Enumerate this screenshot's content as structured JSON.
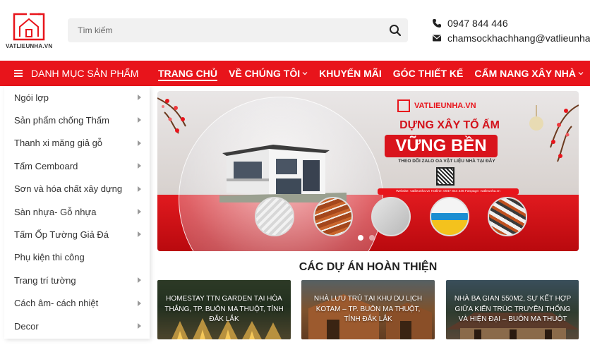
{
  "header": {
    "logo_text": "VATLIEUNHA.VN",
    "search_placeholder": "Tìm kiếm",
    "phone": "0947 844 446",
    "email": "chamsockhachhang@vatlieunha"
  },
  "nav": {
    "category_label": "DANH MỤC SẢN PHẨM",
    "items": [
      {
        "label": "TRANG CHỦ",
        "active": true
      },
      {
        "label": "VỀ CHÚNG TÔI",
        "dropdown": true
      },
      {
        "label": "KHUYẾN MÃI"
      },
      {
        "label": "GÓC THIẾT KẾ"
      },
      {
        "label": "CẨM NANG XÂY NHÀ",
        "dropdown": true
      }
    ]
  },
  "sidebar": {
    "items": [
      {
        "label": "Ngói lợp",
        "has_sub": true
      },
      {
        "label": "Sản phẩm chống Thấm",
        "has_sub": true
      },
      {
        "label": "Thanh xi măng giả gỗ",
        "has_sub": true
      },
      {
        "label": "Tấm Cemboard",
        "has_sub": true
      },
      {
        "label": "Sơn và hóa chất xây dựng",
        "has_sub": true
      },
      {
        "label": "Sàn nhựa- Gỗ nhựa",
        "has_sub": true
      },
      {
        "label": "Tấm Ốp Tường Giả Đá",
        "has_sub": true
      },
      {
        "label": "Phụ kiện thi công",
        "has_sub": false
      },
      {
        "label": "Trang trí tường",
        "has_sub": true
      },
      {
        "label": "Cách âm- cách nhiệt",
        "has_sub": true
      },
      {
        "label": "Decor",
        "has_sub": true
      }
    ]
  },
  "banner": {
    "brand": "VATLIEUNHA.VN",
    "title_line1": "DỰNG XÂY TỔ ẤM",
    "title_line2": "VỮNG BỀN",
    "subtitle": "THEO DÕI ZALO OA VẬT LIỆU NHÀ TẠI ĐÂY",
    "info": "Website: vatlieunha.vn   Hotline: 0947 844 446   Fanpage: vatlieunha.vn",
    "slide_count": 2,
    "active_slide": 1
  },
  "projects": {
    "title": "CÁC DỰ ÁN HOÀN THIỆN",
    "cards": [
      {
        "title": "HOMESTAY TTN GARDEN TẠI HÒA THẮNG, TP. BUÔN MA THUỘT, TỈNH ĐẮK LẮK"
      },
      {
        "title": "NHÀ LƯU TRÚ TẠI KHU DU LỊCH KOTAM – TP. BUÔN MA THUỘT, TỈNH ĐẮK LẮK"
      },
      {
        "title": "NHÀ BA GIAN 550M2, SỰ KẾT HỢP GIỮA KIẾN TRÚC TRUYỀN THỐNG VÀ HIỆN ĐẠI – BUÔN MA THUỘT"
      }
    ]
  },
  "colors": {
    "primary": "#e8141b",
    "text": "#222222"
  }
}
